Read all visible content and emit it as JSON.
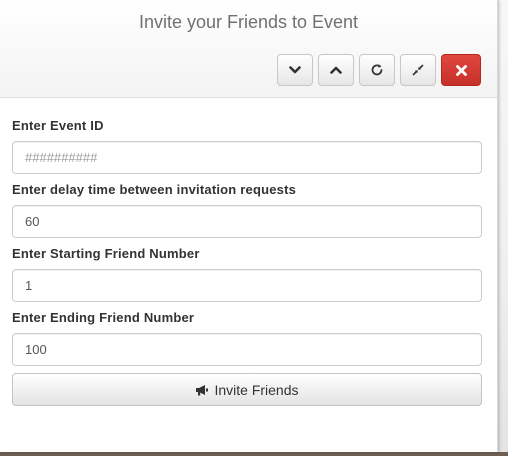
{
  "dialog": {
    "title": "Invite your Friends to Event"
  },
  "toolbar": {
    "buttons": [
      {
        "icon": "chevron-down-icon"
      },
      {
        "icon": "chevron-up-icon"
      },
      {
        "icon": "refresh-icon"
      },
      {
        "icon": "collapse-icon"
      },
      {
        "icon": "close-icon",
        "color": "#d9413a"
      }
    ]
  },
  "form": {
    "event_id": {
      "label": "Enter Event ID",
      "value": "",
      "placeholder": "##########"
    },
    "delay": {
      "label": "Enter delay time between invitation requests",
      "value": "60"
    },
    "start": {
      "label": "Enter Starting Friend Number",
      "value": "1"
    },
    "end": {
      "label": "Enter Ending Friend Number",
      "value": "100"
    },
    "submit": {
      "label": "Invite Friends",
      "icon": "bullhorn-icon"
    }
  }
}
